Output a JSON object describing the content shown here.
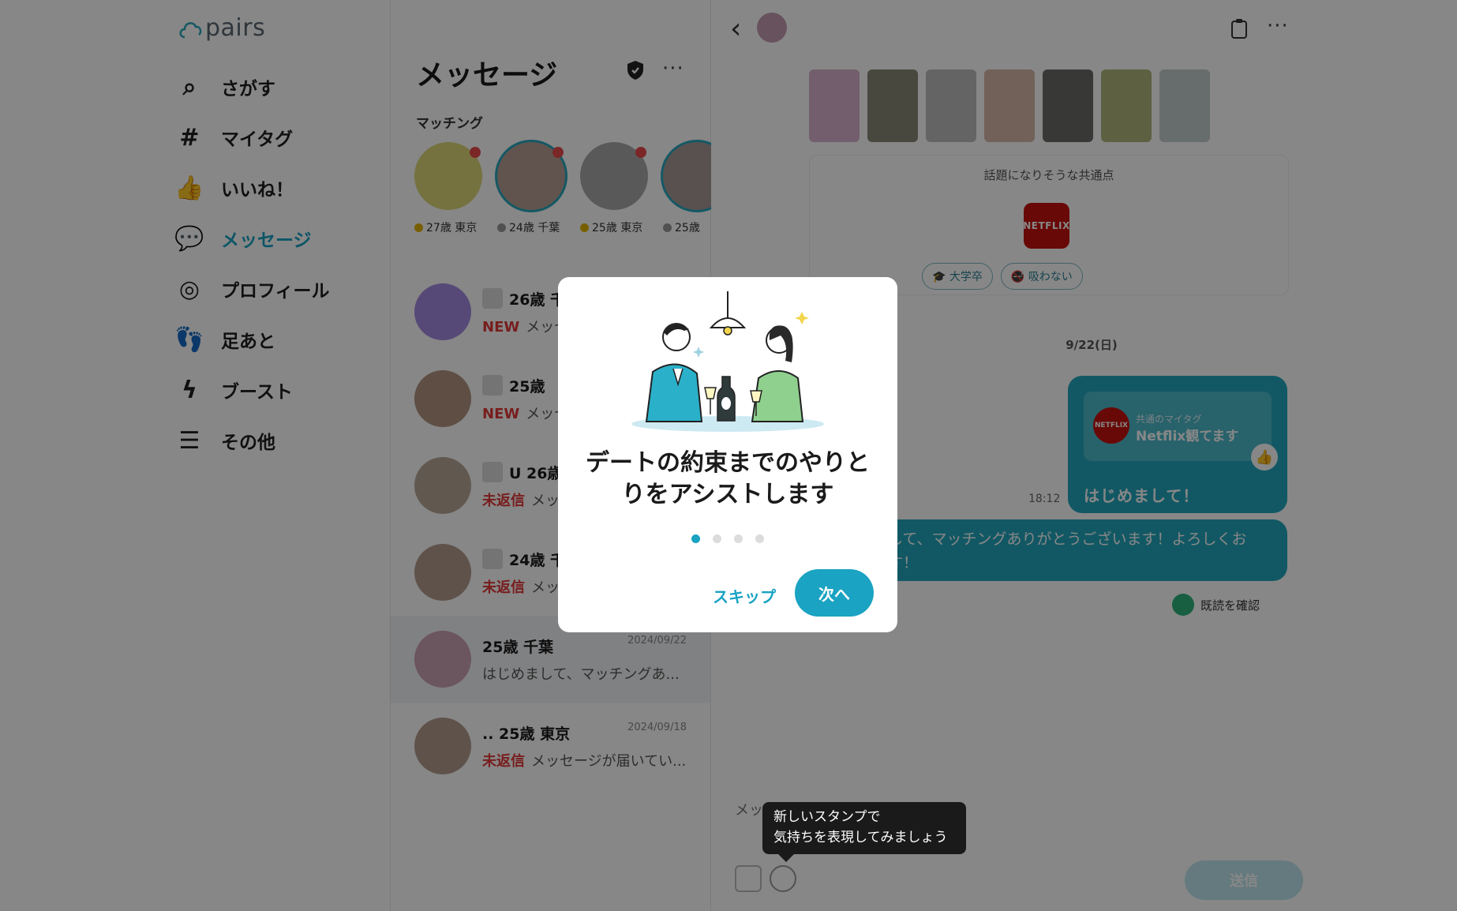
{
  "brand": {
    "logo_text": "pairs",
    "accent": "#1aa3c2"
  },
  "nav": {
    "items": [
      {
        "label": "さがす",
        "icon": "search-icon"
      },
      {
        "label": "マイタグ",
        "icon": "hashtag-icon"
      },
      {
        "label": "いいね！",
        "icon": "thumbs-up-icon"
      },
      {
        "label": "メッセージ",
        "icon": "message-bubble-icon",
        "active": true
      },
      {
        "label": "プロフィール",
        "icon": "profile-icon"
      },
      {
        "label": "足あと",
        "icon": "footprints-icon"
      },
      {
        "label": "ブースト",
        "icon": "bolt-icon"
      },
      {
        "label": "その他",
        "icon": "menu-list-icon"
      }
    ]
  },
  "list": {
    "title": "メッセージ",
    "matching_label": "マッチング",
    "matches": [
      {
        "meta": "27歳 東京",
        "avatar_color": "#ddd77a",
        "status_color": "#e0b400"
      },
      {
        "meta": "24歳 千葉",
        "avatar_color": "#b89f93",
        "status_color": "#9a9a9a"
      },
      {
        "meta": "25歳 東京",
        "avatar_color": "#a9a9a9",
        "status_color": "#e0b400"
      },
      {
        "meta": "25歳",
        "avatar_color": "#a69a98",
        "status_color": "#9a9a9a"
      }
    ],
    "conversations": [
      {
        "name": "26歳 千",
        "badge": "NEW",
        "preview": "メッセ",
        "date": "",
        "avatar_color": "#a48be0",
        "badge_kind": "new"
      },
      {
        "name": "25歳",
        "badge": "NEW",
        "preview": "メッセ",
        "date": "",
        "avatar_color": "#b29381",
        "badge_kind": "new"
      },
      {
        "name": "U 26歳 東",
        "badge": "未返信",
        "preview": "メッセ",
        "date": "",
        "avatar_color": "#b8a698",
        "badge_kind": "unreplied"
      },
      {
        "name": "24歳 千",
        "badge": "未返信",
        "preview": "メッセ",
        "date": "",
        "avatar_color": "#b49c8e",
        "badge_kind": "unreplied"
      },
      {
        "name": "25歳 千葉",
        "badge": "",
        "preview": "はじめまして、マッチングあ...",
        "date": "2024/09/22",
        "avatar_color": "#caa0b4",
        "badge_kind": ""
      },
      {
        "name": "..  25歳 東京",
        "badge": "未返信",
        "preview": "メッセージが届いてい...",
        "date": "2024/09/18",
        "avatar_color": "#b49c8e",
        "badge_kind": "unreplied"
      }
    ]
  },
  "chat": {
    "photo_colors": [
      "#d9b1cf",
      "#888878",
      "#bdbdbd",
      "#d5b8a8",
      "#6b6b68",
      "#b0b87e",
      "#c3cfcc"
    ],
    "common_title": "話題になりそうな共通点",
    "netflix_label": "NETFLIX",
    "chips": [
      "大学卒",
      "吸わない"
    ],
    "date_separator": "9/22(日)",
    "stamp_caption": "共通のマイタグ",
    "stamp_tag": "Netflix観てます",
    "greeting": "はじめまして！",
    "time": "18:12",
    "long_message": "して、マッチングありがとうございます！よろしくお\nす！",
    "read_confirm": "既読を確認",
    "compose_placeholder": "メッ",
    "send_label": "送信"
  },
  "tooltip": {
    "line1": "新しいスタンプで",
    "line2": "気持ちを表現してみましょう"
  },
  "modal": {
    "title_line1": "デートの約束までのやりと",
    "title_line2": "りをアシストします",
    "dot_count": 4,
    "active_dot": 0,
    "skip_label": "スキップ",
    "next_label": "次へ"
  }
}
